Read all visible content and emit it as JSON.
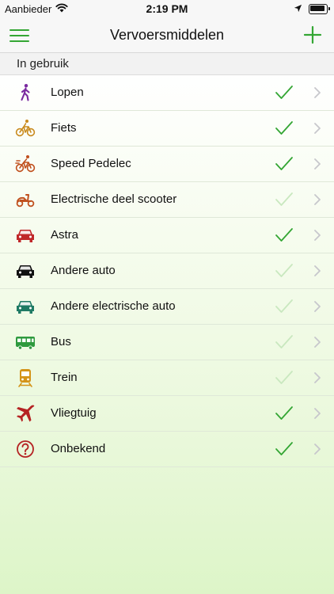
{
  "status_bar": {
    "carrier": "Aanbieder",
    "time": "2:19 PM"
  },
  "header": {
    "title": "Vervoersmiddelen"
  },
  "section": {
    "title": "In gebruik"
  },
  "colors": {
    "accent": "#34a634",
    "check_on": "#34a634",
    "check_off": "#c9e8bf",
    "chevron": "#c7c7cc"
  },
  "items": [
    {
      "label": "Lopen",
      "icon": "walk-icon",
      "enabled": true
    },
    {
      "label": "Fiets",
      "icon": "bicycle-icon",
      "enabled": true
    },
    {
      "label": "Speed Pedelec",
      "icon": "speed-pedelec-icon",
      "enabled": true
    },
    {
      "label": "Electrische deel scooter",
      "icon": "scooter-icon",
      "enabled": false
    },
    {
      "label": "Astra",
      "icon": "car-icon",
      "enabled": true
    },
    {
      "label": "Andere auto",
      "icon": "car-icon",
      "enabled": false
    },
    {
      "label": "Andere electrische auto",
      "icon": "electric-car-icon",
      "enabled": false
    },
    {
      "label": "Bus",
      "icon": "bus-icon",
      "enabled": false
    },
    {
      "label": "Trein",
      "icon": "train-icon",
      "enabled": false
    },
    {
      "label": "Vliegtuig",
      "icon": "airplane-icon",
      "enabled": true
    },
    {
      "label": "Onbekend",
      "icon": "question-icon",
      "enabled": true
    }
  ]
}
